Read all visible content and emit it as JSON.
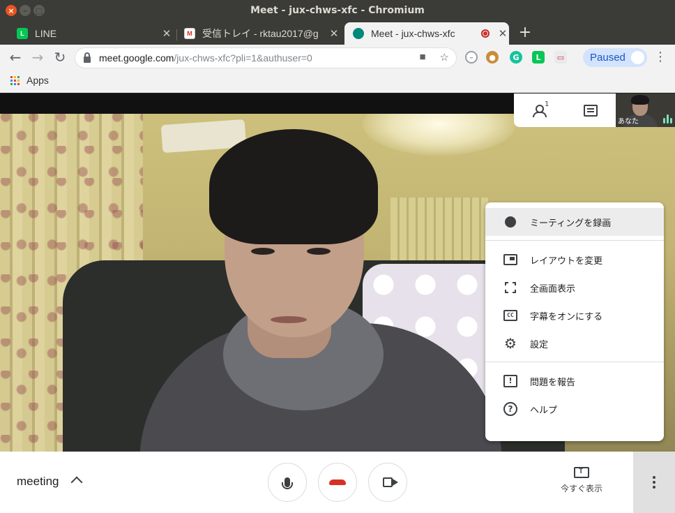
{
  "window": {
    "title": "Meet - jux-chws-xfc - Chromium",
    "close_glyph": "×",
    "minimize_glyph": "–",
    "maximize_glyph": "□"
  },
  "tabs": [
    {
      "label": "LINE",
      "icon": "line-icon",
      "active": false
    },
    {
      "label": "受信トレイ - rktau2017@g",
      "icon": "gmail-icon",
      "active": false
    },
    {
      "label": "Meet - jux-chws-xfc",
      "icon": "meet-icon",
      "active": true,
      "recording": true
    }
  ],
  "tab_close_glyph": "✕",
  "new_tab_glyph": "+",
  "toolbar": {
    "back_glyph": "←",
    "forward_glyph": "→",
    "reload_glyph": "↻",
    "url_host": "meet.google.com",
    "url_path": "/jux-chws-xfc?pli=1&authuser=0",
    "camera_glyph": "■",
    "star_glyph": "☆",
    "paused_label": "Paused",
    "menu_glyph": "⋮",
    "extensions": [
      "adblock-icon",
      "cookie-icon",
      "grammarly-icon",
      "line-extension-icon",
      "cast-icon"
    ]
  },
  "bookmarks": {
    "apps_label": "Apps"
  },
  "meet": {
    "participants_count": "1",
    "self_label": "あなた",
    "meeting_name": "meeting",
    "present_label": "今すぐ表示"
  },
  "menu": {
    "items": [
      {
        "label": "ミーティングを録画",
        "icon": "record-icon"
      },
      {
        "label": "レイアウトを変更",
        "icon": "layout-icon"
      },
      {
        "label": "全画面表示",
        "icon": "fullscreen-icon"
      },
      {
        "label": "字幕をオンにする",
        "icon": "captions-icon"
      },
      {
        "label": "設定",
        "icon": "settings-gear-icon"
      },
      {
        "label": "問題を報告",
        "icon": "report-problem-icon"
      },
      {
        "label": "ヘルプ",
        "icon": "help-icon"
      }
    ],
    "captions_glyph": "CC",
    "report_glyph": "!",
    "help_glyph": "?",
    "gear_glyph": "⚙"
  },
  "colors": {
    "accent": "#1a73e8",
    "hangup": "#d93025",
    "recording": "#d32f2f",
    "title_bar": "#3b3b37",
    "paused_bg": "#d3e3fd"
  }
}
